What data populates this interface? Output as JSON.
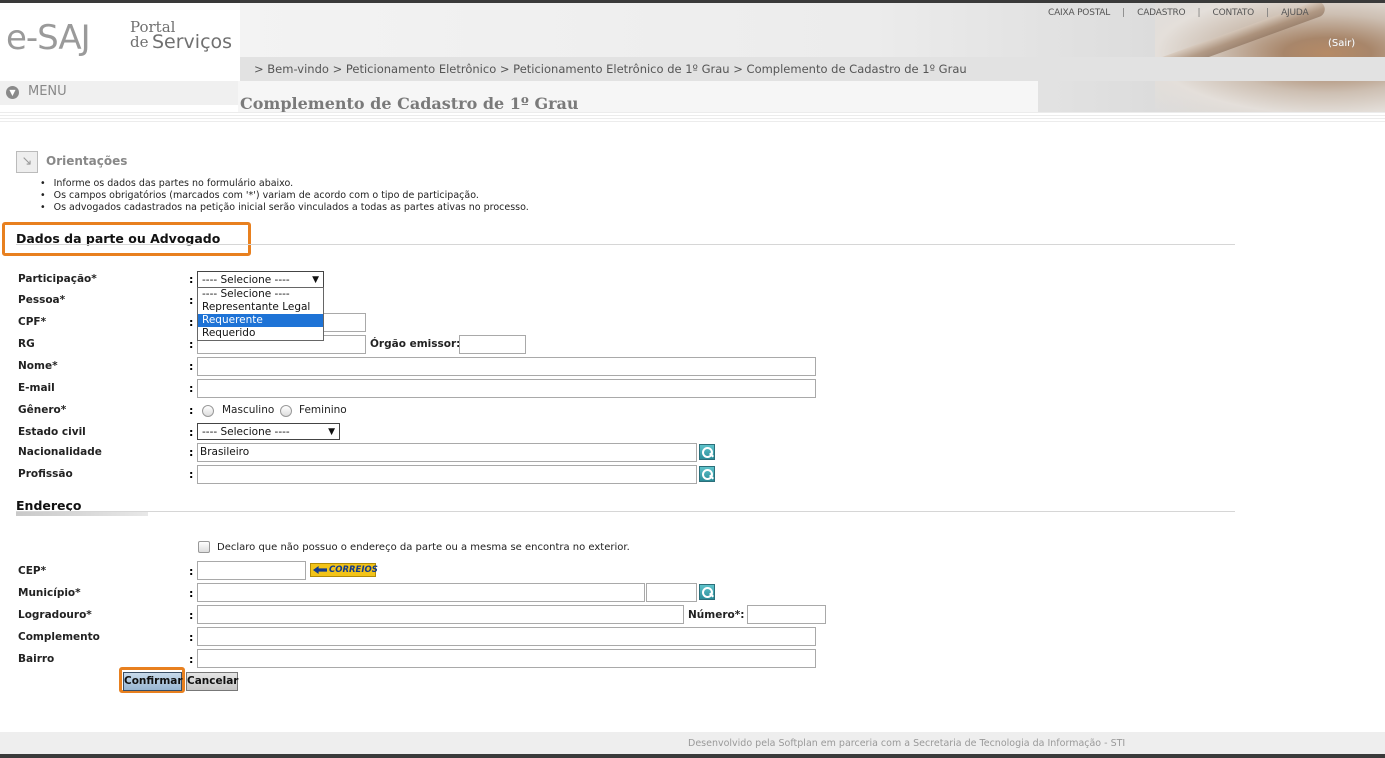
{
  "header": {
    "logo_esaj": "e-SAJ",
    "logo_portal": "Portal",
    "logo_de": "de",
    "logo_servicos": "Serviços",
    "nav": [
      "CAIXA POSTAL",
      "CADASTRO",
      "CONTATO",
      "AJUDA"
    ],
    "nav_sep": "|",
    "sair": "(Sair)",
    "breadcrumb": "> Bem-vindo > Peticionamento Eletrônico > Peticionamento Eletrônico de 1º Grau > Complemento de Cadastro de 1º Grau",
    "menu_label": "MENU",
    "menu_icon": "chevron-down-icon",
    "page_title": "Complemento de Cadastro de 1º Grau"
  },
  "orientacoes": {
    "title": "Orientações",
    "icon": "arrow-down-right-icon",
    "items": [
      "Informe os dados das partes no formulário abaixo.",
      "Os campos obrigatórios (marcados com '*') variam de acordo com o tipo de participação.",
      "Os advogados cadastrados na petição inicial serão vinculados a todas as partes ativas no processo."
    ]
  },
  "dados": {
    "section_title": "Dados da parte ou Advogado",
    "participacao_label": "Participação*",
    "participacao_value": "---- Selecione ----",
    "participacao_options": [
      "---- Selecione ----",
      "Representante Legal",
      "Requerente",
      "Requerido"
    ],
    "participacao_highlighted": "Requerente",
    "pessoa_label": "Pessoa*",
    "cpf_label": "CPF*",
    "rg_label": "RG",
    "orgao_label": "Órgão emissor:",
    "nome_label": "Nome*",
    "email_label": "E-mail",
    "genero_label": "Gênero*",
    "genero_masc": "Masculino",
    "genero_fem": "Feminino",
    "estado_civil_label": "Estado civil",
    "estado_civil_value": "---- Selecione ----",
    "nacionalidade_label": "Nacionalidade",
    "nacionalidade_value": "Brasileiro",
    "profissao_label": "Profissão",
    "colon": ":"
  },
  "endereco": {
    "section_title": "Endereço",
    "exterior_checkbox_label": "Declaro que não possuo o endereço da parte ou a mesma se encontra no exterior.",
    "cep_label": "CEP*",
    "correios_label": "CORREIOS",
    "municipio_label": "Município*",
    "logradouro_label": "Logradouro*",
    "numero_label": "Número*:",
    "complemento_label": "Complemento",
    "bairro_label": "Bairro"
  },
  "buttons": {
    "confirmar": "Confirmar",
    "cancelar": "Cancelar"
  },
  "footer": {
    "text": "Desenvolvido pela Softplan em parceria com a Secretaria de Tecnologia da Informação - STI"
  },
  "colors": {
    "highlight": "#e8801f",
    "selected_option": "#1e73d6",
    "lookup_button": "#2b8c98"
  }
}
